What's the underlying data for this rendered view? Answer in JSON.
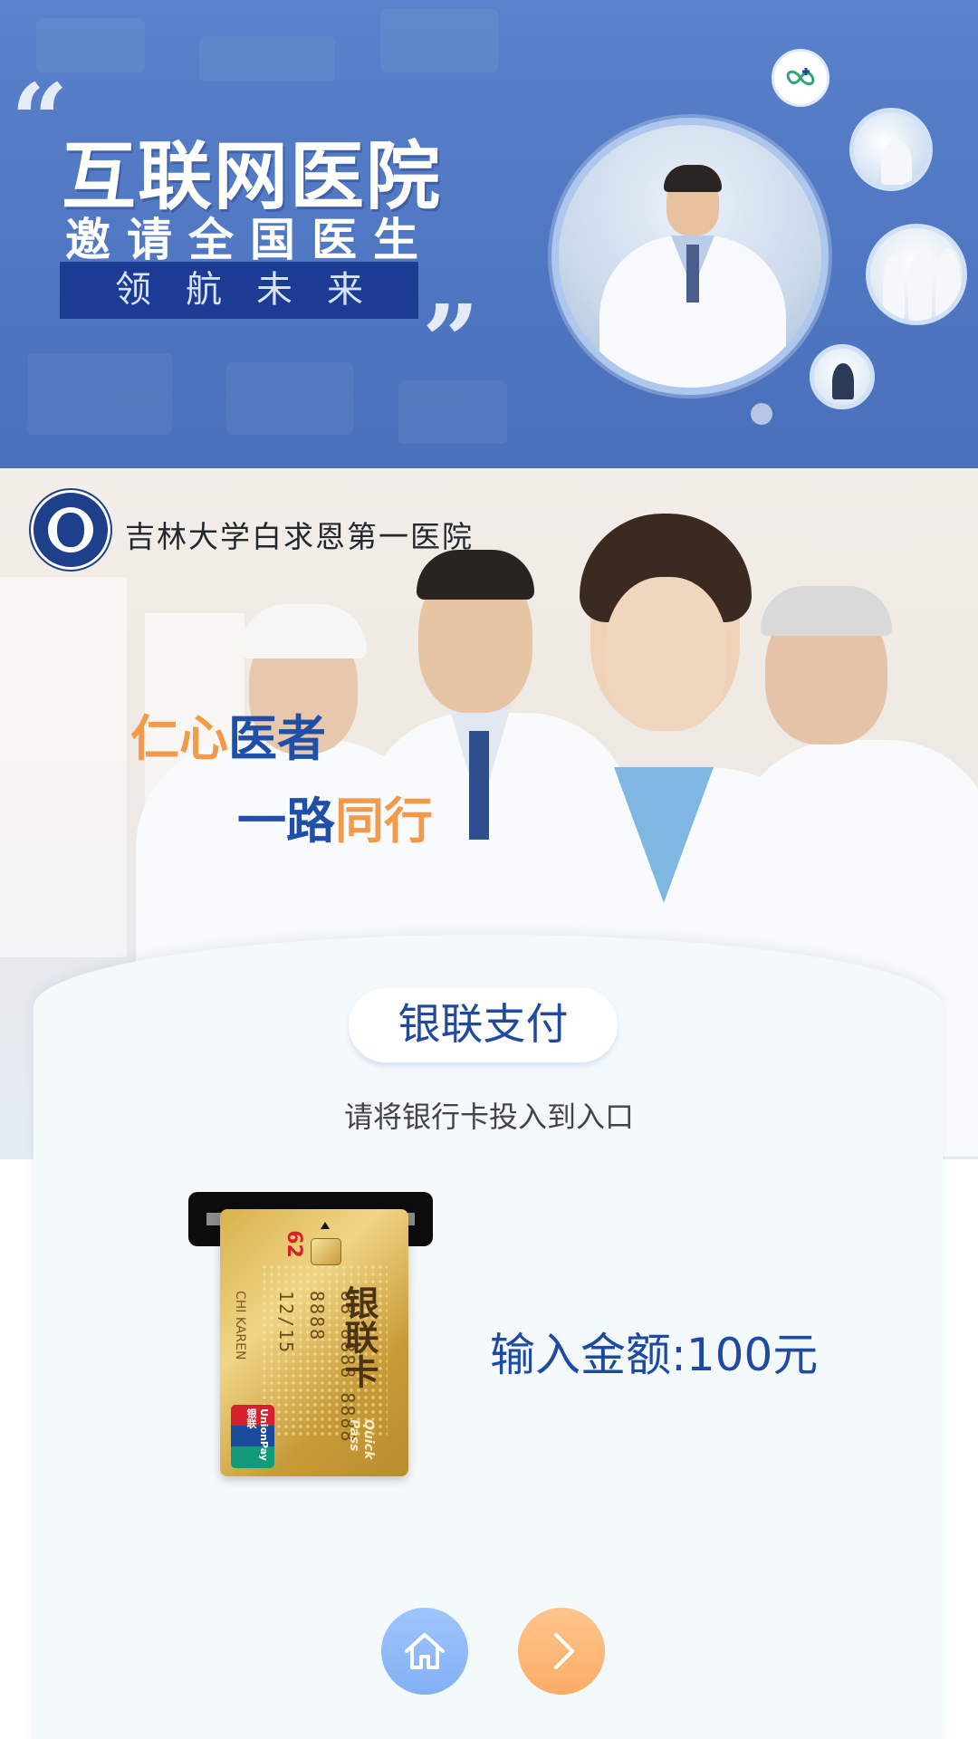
{
  "banner": {
    "title": "互联网医院",
    "subtitle": "邀请全国医生",
    "slogan": "领航未来",
    "quote_open": "“",
    "quote_close": "”",
    "logo_icon": "clover-cross-icon"
  },
  "hospital": {
    "name": "吉林大学白求恩第一医院",
    "logo_icon": "hospital-seal-icon"
  },
  "motto": {
    "line1_orange": "仁心",
    "line1_blue": "医者",
    "line2_blue": "一路",
    "line2_orange": "同行"
  },
  "payment": {
    "title": "银联支付",
    "instruction": "请将银行卡投入到入口",
    "amount_text": "输入金额:100元"
  },
  "card": {
    "label": "银联卡",
    "prefix": "62",
    "number_lines": [
      "88 8888 8888 8888",
      "12/15"
    ],
    "holder": "CHI KAREN",
    "brand": "UnionPay 银联",
    "quickpass": "Quick Pass"
  },
  "nav": {
    "home_icon": "home-icon",
    "next_icon": "chevron-right-icon"
  },
  "colors": {
    "banner_blue": "#5a82cb",
    "title_blue": "#1f4aa0",
    "motto_orange": "#f2994a",
    "home_button": "#8fb9f8",
    "next_button": "#fdb673"
  }
}
